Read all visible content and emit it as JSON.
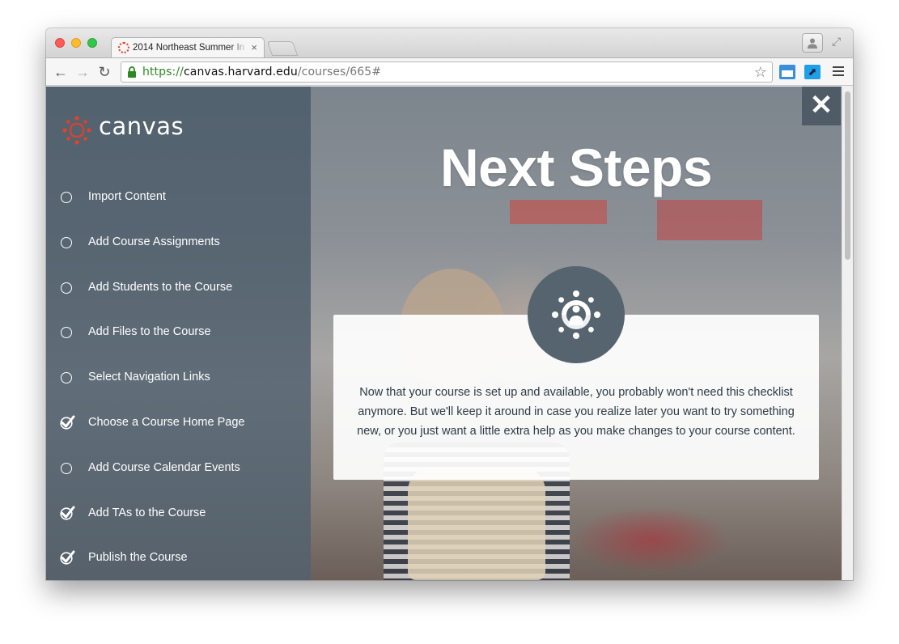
{
  "browser": {
    "tab_title": "2014 Northeast Summer In",
    "tab_close": "×",
    "url_scheme": "https://",
    "url_host": "canvas.harvard.edu",
    "url_path": "/courses/665#",
    "star": "☆",
    "fullscreen": "⤢",
    "ext_icon_2": "⬈"
  },
  "nav": {
    "back": "←",
    "forward": "→",
    "reload": "↻"
  },
  "sidebar": {
    "logo_text": "canvas",
    "items": [
      {
        "label": "Import Content",
        "checked": false
      },
      {
        "label": "Add Course Assignments",
        "checked": false
      },
      {
        "label": "Add Students to the Course",
        "checked": false
      },
      {
        "label": "Add Files to the Course",
        "checked": false
      },
      {
        "label": "Select Navigation Links",
        "checked": false
      },
      {
        "label": "Choose a Course Home Page",
        "checked": true
      },
      {
        "label": "Add Course Calendar Events",
        "checked": false
      },
      {
        "label": "Add TAs to the Course",
        "checked": true
      },
      {
        "label": "Publish the Course",
        "checked": true
      }
    ]
  },
  "main": {
    "close_label": "✕",
    "headline": "Next Steps",
    "message": "Now that your course is set up and available, you probably won't need this checklist anymore. But we'll keep it around in case you realize later you want to try something new, or you just want a little extra help as you make changes to your course content."
  },
  "colors": {
    "brand_red": "#e2412a",
    "sidebar_bg": "#50606e",
    "badge_bg": "#56646f",
    "text_dark": "#2d3b45",
    "url_green": "#2a8a1f"
  }
}
